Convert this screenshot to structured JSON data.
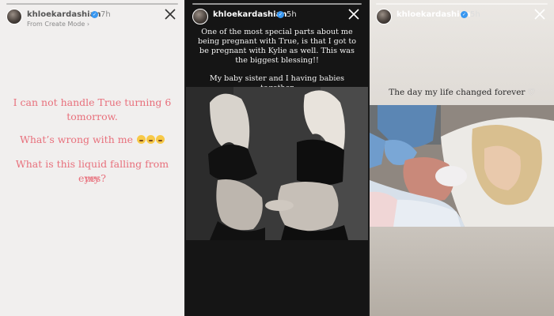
{
  "stories": [
    {
      "username": "khloekardashian",
      "time": "7h",
      "subtitle": "From Create Mode ›",
      "lines": [
        "I can not handle True turning 6",
        "tomorrow.",
        "What’s wrong with me",
        "What is this liquid falling from my",
        "eyes?"
      ],
      "emoji_names": [
        "pleading-face-emoji",
        "pleading-face-emoji",
        "pleading-face-emoji"
      ]
    },
    {
      "username": "khloekardashian",
      "time": "5h",
      "lines": [
        "One of the most special parts about me",
        "being pregnant with True, is that I got to",
        "be pregnant with Kylie as well. This was",
        "the biggest blessing!!",
        "My baby sister and I having babies",
        "together"
      ]
    },
    {
      "username": "khloekardashian",
      "time": "5h",
      "caption": "The day my life changed forever",
      "heart": "♡"
    }
  ],
  "icons": {
    "close": "close-icon",
    "verified": "verified-badge-icon"
  },
  "colors": {
    "pink_text": "#e8707c",
    "verified": "#3897f0"
  }
}
